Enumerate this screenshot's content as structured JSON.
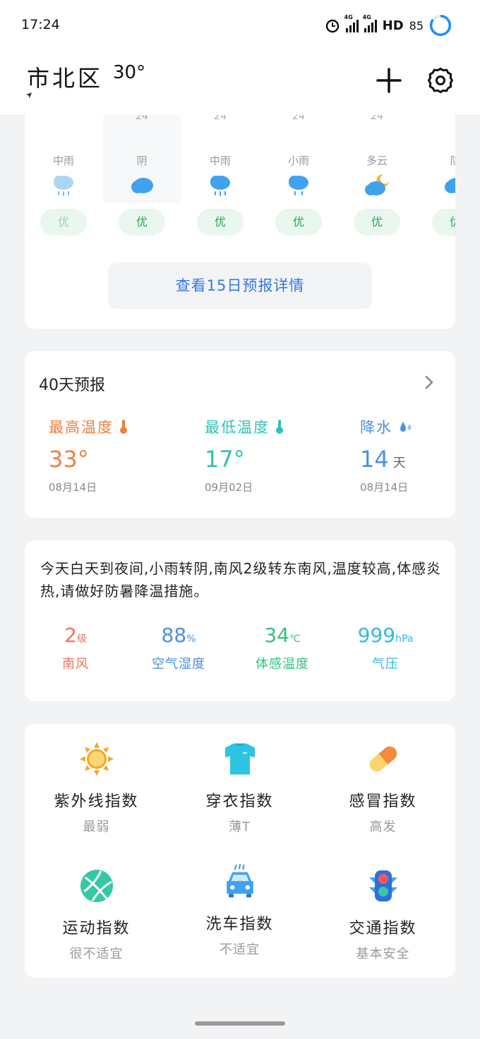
{
  "status_bar": {
    "time": "17:24",
    "net1": "4G",
    "net2": "4G",
    "hd": "HD",
    "battery": "85"
  },
  "header": {
    "city": "市北区",
    "temperature": "30°"
  },
  "forecast_strip": {
    "days": [
      {
        "top_value": "",
        "condition": "中雨",
        "aqi": "优",
        "icon": "rain-cloud-icon"
      },
      {
        "top_value": "24",
        "condition": "阴",
        "aqi": "优",
        "icon": "overcast-cloud-icon",
        "selected": true
      },
      {
        "top_value": "24",
        "condition": "中雨",
        "aqi": "优",
        "icon": "rain-cloud-icon"
      },
      {
        "top_value": "24",
        "condition": "小雨",
        "aqi": "优",
        "icon": "rain-cloud-icon"
      },
      {
        "top_value": "24",
        "condition": "多云",
        "aqi": "优",
        "icon": "cloudy-moon-icon"
      },
      {
        "top_value": "",
        "condition": "阴",
        "aqi": "优",
        "icon": "overcast-cloud-icon"
      }
    ],
    "detail_button": "查看15日预报详情"
  },
  "forecast_40": {
    "title": "40天预报",
    "high": {
      "label": "最高温度",
      "value": "33°",
      "date": "08月14日",
      "color": "#f07f3c"
    },
    "low": {
      "label": "最低温度",
      "value": "17°",
      "date": "09月02日",
      "color": "#2fc3b7"
    },
    "rain": {
      "label": "降水",
      "value": "14",
      "unit": "天",
      "date": "08月14日",
      "color": "#4a90e2"
    }
  },
  "summary": {
    "text": "今天白天到夜间,小雨转阴,南风2级转东南风,温度较高,体感炎热,请做好防暑降温措施。",
    "metrics": [
      {
        "value": "2",
        "unit": "级",
        "label": "南风",
        "color": "#f0735a"
      },
      {
        "value": "88",
        "unit": "%",
        "label": "空气湿度",
        "color": "#4a90e2"
      },
      {
        "value": "34",
        "unit": "℃",
        "label": "体感温度",
        "color": "#35c17d"
      },
      {
        "value": "999",
        "unit": "hPa",
        "label": "气压",
        "color": "#36b8e6"
      }
    ]
  },
  "indices": [
    {
      "title": "紫外线指数",
      "value": "最弱",
      "icon": "sun-icon"
    },
    {
      "title": "穿衣指数",
      "value": "薄T",
      "icon": "tshirt-icon"
    },
    {
      "title": "感冒指数",
      "value": "高发",
      "icon": "pill-icon"
    },
    {
      "title": "运动指数",
      "value": "很不适宜",
      "icon": "ball-icon"
    },
    {
      "title": "洗车指数",
      "value": "不适宜",
      "icon": "car-icon"
    },
    {
      "title": "交通指数",
      "value": "基本安全",
      "icon": "traffic-light-icon"
    }
  ]
}
